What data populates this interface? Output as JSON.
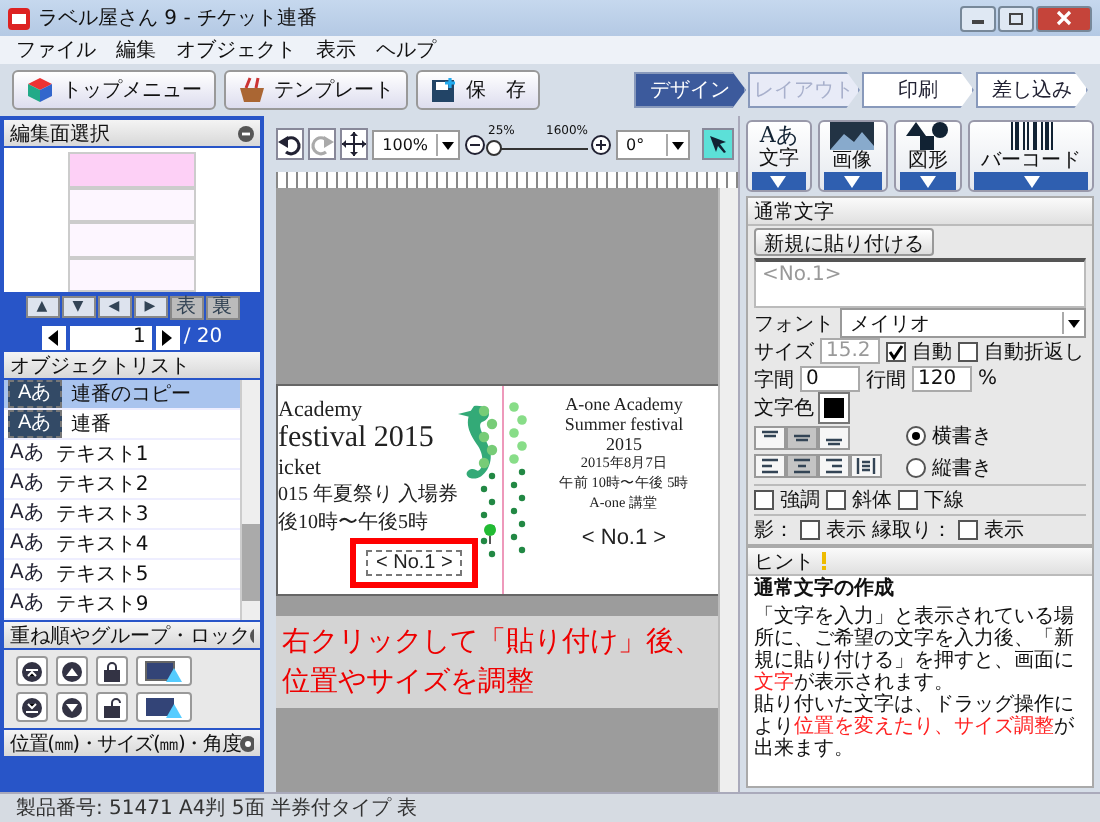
{
  "window": {
    "title": "ラベル屋さん 9 - チケット連番"
  },
  "menu": [
    "ファイル",
    "編集",
    "オブジェクト",
    "表示",
    "ヘルプ"
  ],
  "toolbar": [
    {
      "label": "トップメニュー",
      "kind": "home"
    },
    {
      "label": "テンプレート",
      "kind": "template"
    },
    {
      "label": "保　存",
      "kind": "save"
    }
  ],
  "steps": [
    {
      "label": "デザイン",
      "selected": true,
      "disabled": false
    },
    {
      "label": "レイアウト",
      "selected": false,
      "disabled": true
    },
    {
      "label": "印刷",
      "selected": false,
      "disabled": false
    },
    {
      "label": "差し込み",
      "selected": false,
      "disabled": false
    }
  ],
  "canvas_toolbar": {
    "zoom": "100%",
    "zoom_slider": {
      "min_label": "25%",
      "max_label": "1600%",
      "level": 0.06
    },
    "rotation": "0°"
  },
  "tools": [
    {
      "label": "文字",
      "kind": "text",
      "glyph": "Aあ"
    },
    {
      "label": "画像",
      "kind": "image"
    },
    {
      "label": "図形",
      "kind": "shape"
    },
    {
      "label": "バーコード",
      "kind": "barcode"
    }
  ],
  "left_panel": {
    "page_select": {
      "title": "編集面選択",
      "arrows": [
        "▲",
        "▼",
        "◀",
        "▶"
      ],
      "sides": [
        "表",
        "裏"
      ],
      "page": "1",
      "total": "/ 20"
    },
    "object_list": {
      "title": "オブジェクトリスト",
      "items": [
        {
          "icon": "Aあ",
          "label": "連番のコピー",
          "kind": "serial",
          "selected": true
        },
        {
          "icon": "Aあ",
          "label": "連番",
          "kind": "serial",
          "selected": false
        },
        {
          "icon": "Aあ",
          "label": "テキスト1",
          "kind": "text",
          "selected": false
        },
        {
          "icon": "Aあ",
          "label": "テキスト2",
          "kind": "text",
          "selected": false
        },
        {
          "icon": "Aあ",
          "label": "テキスト3",
          "kind": "text",
          "selected": false
        },
        {
          "icon": "Aあ",
          "label": "テキスト4",
          "kind": "text",
          "selected": false
        },
        {
          "icon": "Aあ",
          "label": "テキスト5",
          "kind": "text",
          "selected": false
        },
        {
          "icon": "Aあ",
          "label": "テキスト9",
          "kind": "text",
          "selected": false
        }
      ]
    },
    "order_title": "重ね順やグループ・ロック",
    "position_title": "位置(㎜)・サイズ(㎜)・角度"
  },
  "ticket": {
    "main": [
      "Academy",
      "festival 2015",
      "icket",
      "015 年夏祭り 入場券",
      "後10時〜午後5時"
    ],
    "serial": "< No.1 >",
    "stub": [
      "A-one Academy",
      "Summer festival",
      "2015",
      "2015年8月7日",
      "午前 10時〜午後 5時",
      "A-one 講堂"
    ],
    "stub_serial": "< No.1 >"
  },
  "caption": [
    "右クリックして「貼り付け」後、",
    "位置やサイズを調整"
  ],
  "properties": {
    "title": "通常文字",
    "paste_button": "新規に貼り付ける",
    "text_value": "<No.1>",
    "font_label": "フォント",
    "font": "メイリオ",
    "size_label": "サイズ",
    "size": "15.2",
    "auto_label": "自動",
    "auto": true,
    "wrap_label": "自動折返し",
    "wrap": false,
    "char_spacing_label": "字間",
    "char_spacing": "0",
    "line_spacing_label": "行間",
    "line_spacing": "120",
    "percent": "%",
    "color_label": "文字色",
    "color": "#000000",
    "valign": [
      {
        "selected": false
      },
      {
        "selected": true
      },
      {
        "selected": false
      }
    ],
    "halign": [
      {
        "selected": false
      },
      {
        "selected": true
      },
      {
        "selected": false
      },
      {
        "selected": false
      }
    ],
    "direction": [
      {
        "label": "横書き",
        "selected": true
      },
      {
        "label": "縦書き",
        "selected": false
      }
    ],
    "styles": [
      {
        "label": "強調",
        "checked": false
      },
      {
        "label": "斜体",
        "checked": false
      },
      {
        "label": "下線",
        "checked": false
      }
    ],
    "effects": [
      {
        "label": "影：",
        "option": "表示",
        "checked": false
      },
      {
        "label": "縁取り：",
        "option": "表示",
        "checked": false
      }
    ]
  },
  "hint": {
    "title": "ヒント",
    "heading": "通常文字の作成",
    "paragraphs": [
      [
        {
          "text": "「文字を入力」と表示されている場所に、ご希望の文字を入力後、「新規に貼り付ける」を押すと、画面に",
          "red": false
        },
        {
          "text": "文字",
          "red": true
        },
        {
          "text": "が表示されます。",
          "red": false
        }
      ],
      [
        {
          "text": "貼り付いた文字は、ドラッグ操作により",
          "red": false
        },
        {
          "text": "位置を変えたり、サイズ調整",
          "red": true
        },
        {
          "text": "が出来ます。",
          "red": false
        }
      ]
    ]
  },
  "status_bar": "製品番号: 51471 A4判 5面 半券付タイプ 表"
}
